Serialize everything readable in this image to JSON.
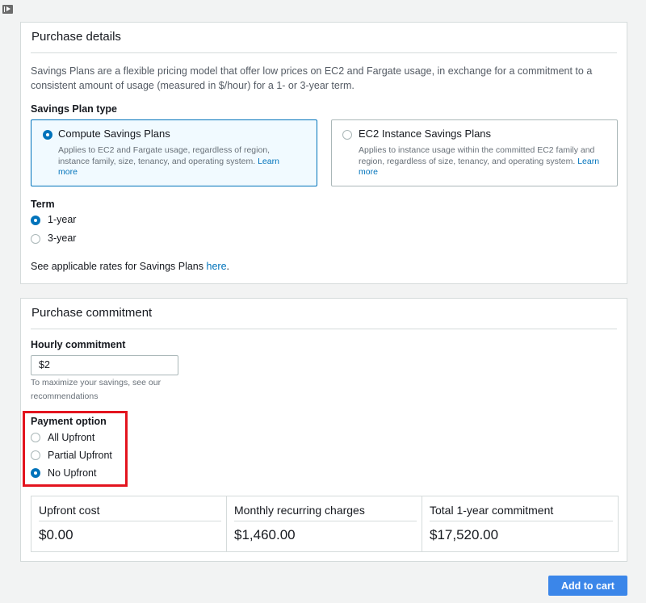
{
  "purchase_details": {
    "title": "Purchase details",
    "description": "Savings Plans are a flexible pricing model that offer low prices on EC2 and Fargate usage, in exchange for a commitment to a consistent amount of usage (measured in $/hour) for a 1- or 3-year term.",
    "plan_type_label": "Savings Plan type",
    "plan_types": [
      {
        "title": "Compute Savings Plans",
        "description": "Applies to EC2 and Fargate usage, regardless of region, instance family, size, tenancy, and operating system.",
        "link": "Learn more",
        "selected": true
      },
      {
        "title": "EC2 Instance Savings Plans",
        "description": "Applies to instance usage within the committed EC2 family and region, regardless of size, tenancy, and operating system.",
        "link": "Learn more",
        "selected": false
      }
    ],
    "term_label": "Term",
    "terms": [
      {
        "label": "1-year",
        "selected": true
      },
      {
        "label": "3-year",
        "selected": false
      }
    ],
    "rates_text": "See applicable rates for Savings Plans",
    "rates_link": "here",
    "rates_suffix": "."
  },
  "purchase_commitment": {
    "title": "Purchase commitment",
    "hourly_label": "Hourly commitment",
    "hourly_value": "$2",
    "hint_text": "To maximize your savings, see our",
    "hint_link": "recommendations",
    "payment_label": "Payment option",
    "payment_options": [
      {
        "label": "All Upfront",
        "selected": false
      },
      {
        "label": "Partial Upfront",
        "selected": false
      },
      {
        "label": "No Upfront",
        "selected": true
      }
    ],
    "summary": [
      {
        "label": "Upfront cost",
        "value": "$0.00"
      },
      {
        "label": "Monthly recurring charges",
        "value": "$1,460.00"
      },
      {
        "label": "Total 1-year commitment",
        "value": "$17,520.00"
      }
    ]
  },
  "actions": {
    "add_to_cart": "Add to cart"
  },
  "colors": {
    "accent": "#0073bb",
    "button": "#3b86e9",
    "highlight": "#e3141e"
  }
}
